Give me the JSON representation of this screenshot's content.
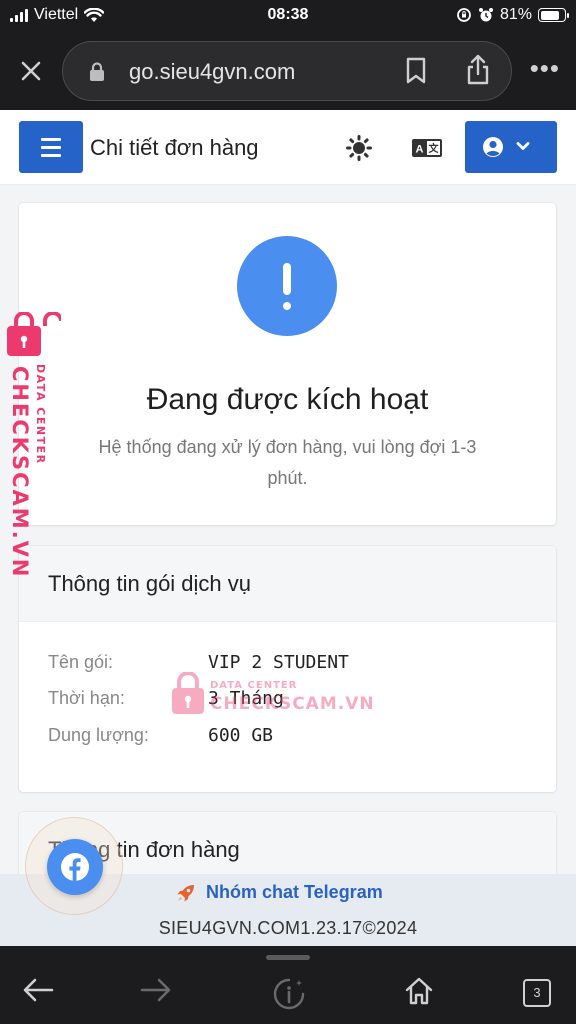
{
  "status_bar": {
    "carrier": "Viettel",
    "time": "08:38",
    "battery": "81%",
    "battery_level": 0.81
  },
  "browser": {
    "url": "go.sieu4gvn.com",
    "tabs_count": "3"
  },
  "header": {
    "title": "Chi tiết đơn hàng"
  },
  "status_card": {
    "title": "Đang được kích hoạt",
    "description": "Hệ thống đang xử lý đơn hàng, vui lòng đợi 1-3 phút."
  },
  "service_card": {
    "title": "Thông tin gói dịch vụ",
    "rows": [
      {
        "label": "Tên gói:",
        "value": "VIP 2 STUDENT"
      },
      {
        "label": "Thời hạn:",
        "value": "3 Tháng"
      },
      {
        "label": "Dung lượng:",
        "value": "600 GB"
      }
    ]
  },
  "order_card": {
    "title": "Thông tin đơn hàng"
  },
  "footer": {
    "telegram_link": "Nhóm chat Telegram",
    "copyright": "SIEU4GVN.COM1.23.17©2024"
  },
  "watermark": {
    "brand": "CHECKSCAM.VN",
    "sub": "DATA CENTER"
  },
  "colors": {
    "primary": "#2563c9",
    "alert": "#4a8ef0",
    "watermark": "#ec3a6e",
    "telegram_icon": "#e8622d"
  },
  "icons": [
    "close-icon",
    "lock-icon",
    "bookmark-icon",
    "share-icon",
    "more-icon",
    "menu-icon",
    "sun-icon",
    "translate-icon",
    "user-icon",
    "chevron-down-icon",
    "alert-icon",
    "rocket-icon",
    "facebook-icon",
    "back-icon",
    "forward-icon",
    "info-icon",
    "home-icon",
    "tabs-icon"
  ]
}
